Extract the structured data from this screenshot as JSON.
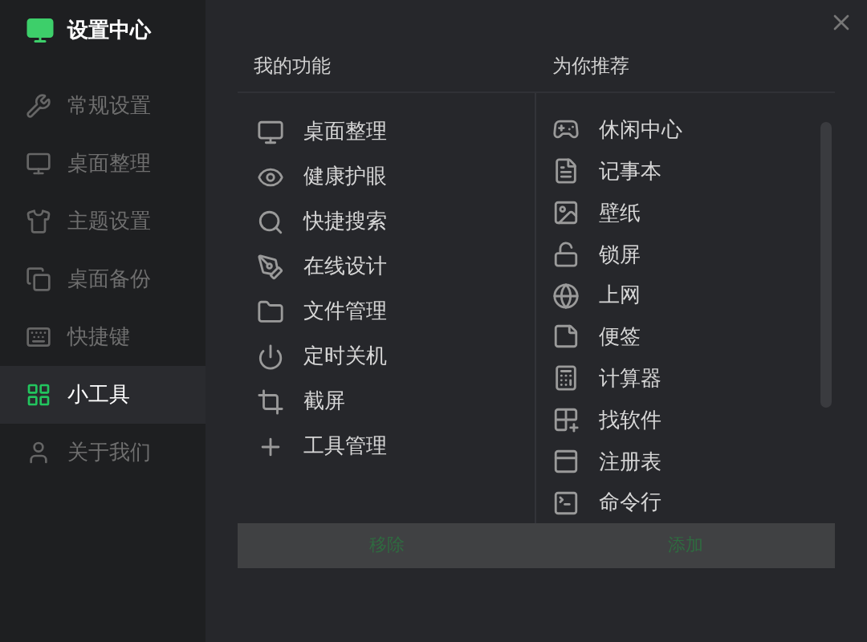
{
  "app": {
    "title": "设置中心"
  },
  "sidebar": {
    "items": [
      {
        "label": "常规设置",
        "selected": false
      },
      {
        "label": "桌面整理",
        "selected": false
      },
      {
        "label": "主题设置",
        "selected": false
      },
      {
        "label": "桌面备份",
        "selected": false
      },
      {
        "label": "快捷键",
        "selected": false
      },
      {
        "label": "小工具",
        "selected": true
      },
      {
        "label": "关于我们",
        "selected": false
      }
    ]
  },
  "my_features": {
    "heading": "我的功能",
    "items": [
      "桌面整理",
      "健康护眼",
      "快捷搜索",
      "在线设计",
      "文件管理",
      "定时关机",
      "截屏",
      "工具管理"
    ]
  },
  "recommended": {
    "heading": "为你推荐",
    "items": [
      "休闲中心",
      "记事本",
      "壁纸",
      "锁屏",
      "上网",
      "便签",
      "计算器",
      "找软件",
      "注册表",
      "命令行"
    ]
  },
  "actions": [
    {
      "label": "移除",
      "disabled": true
    },
    {
      "label": "添加",
      "disabled": true
    }
  ]
}
